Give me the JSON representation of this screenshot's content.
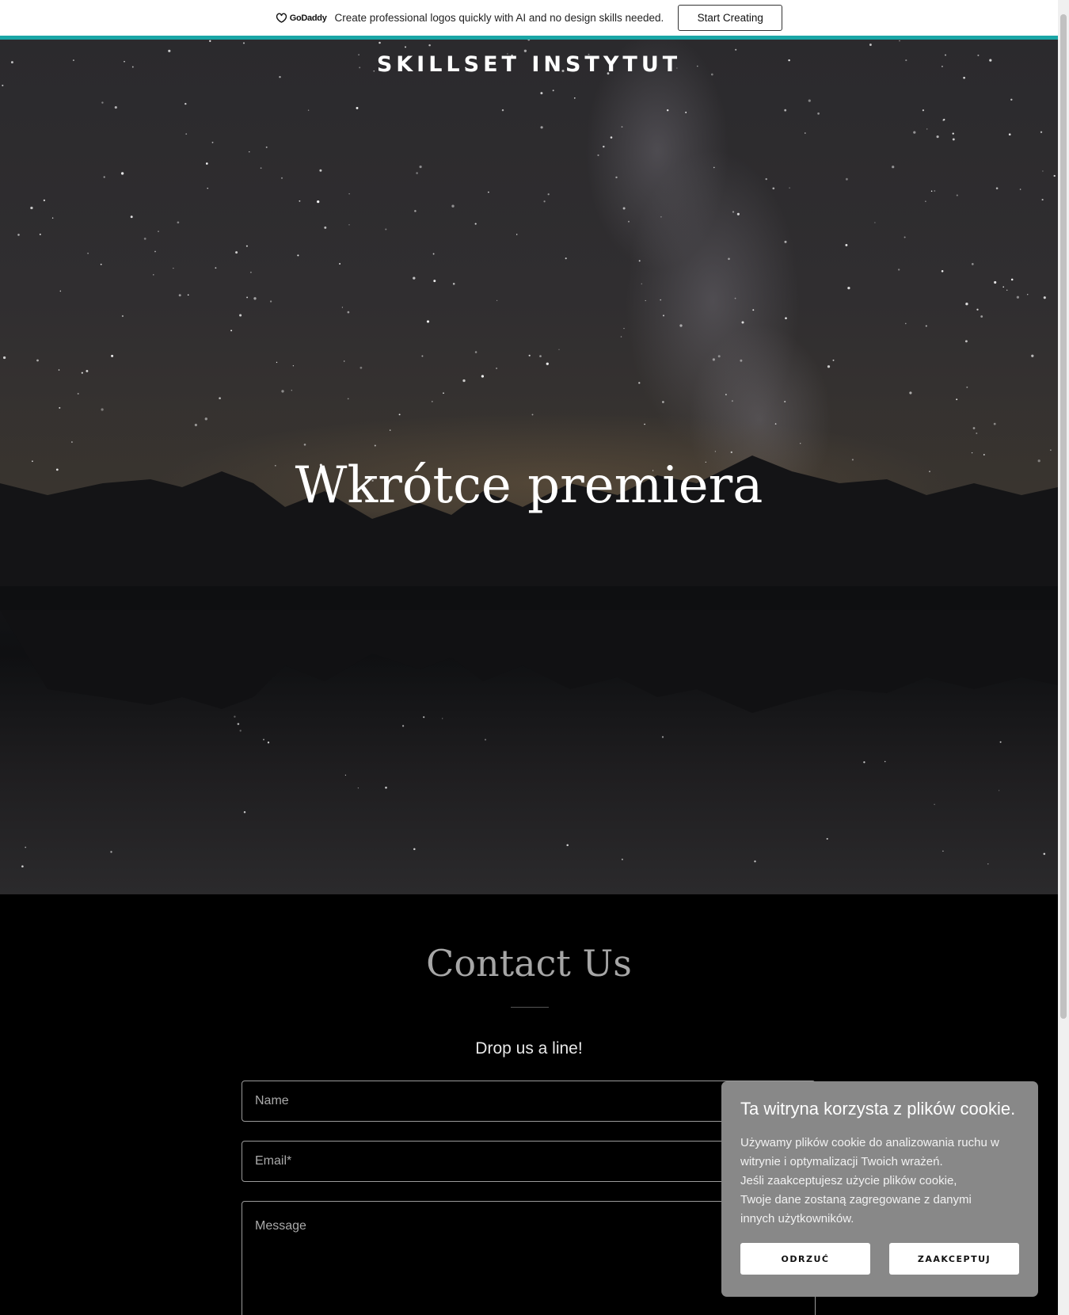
{
  "promo": {
    "brand": "GoDaddy",
    "text": "Create professional logos quickly with AI and no design skills needed.",
    "button": "Start Creating",
    "accent_color": "#1aa6a6"
  },
  "hero": {
    "site_title": "SKILLSET INSTYTUT",
    "heading": "Wkrótce premiera"
  },
  "contact": {
    "title": "Contact Us",
    "subtitle": "Drop us a line!",
    "name_placeholder": "Name",
    "email_placeholder": "Email*",
    "message_placeholder": "Message"
  },
  "cookie": {
    "title": "Ta witryna korzysta z plików cookie.",
    "body_lines": [
      "Używamy plików cookie do analizowania ruchu w",
      "witrynie i optymalizacji Twoich wrażeń.",
      "Jeśli zaakceptujesz użycie plików cookie,",
      "Twoje dane zostaną zagregowane z danymi",
      "innych użytkowników."
    ],
    "decline": "ODRZUĆ",
    "accept": "ZAAKCEPTUJ"
  }
}
